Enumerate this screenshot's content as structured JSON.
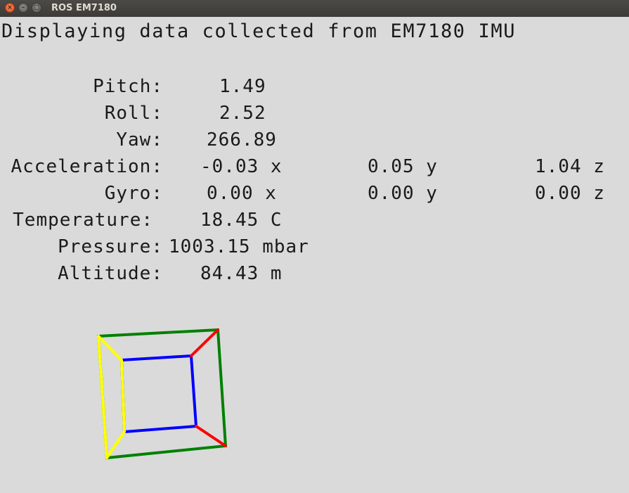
{
  "window": {
    "title": "ROS EM7180",
    "close_glyph": "×",
    "min_glyph": "–",
    "max_glyph": "□"
  },
  "heading": "Displaying data collected from EM7180 IMU",
  "readings": {
    "pitch": {
      "label": "Pitch:",
      "value": "1.49"
    },
    "roll": {
      "label": "Roll:",
      "value": "2.52"
    },
    "yaw": {
      "label": "Yaw:",
      "value": "266.89"
    },
    "accel": {
      "label": "Acceleration:",
      "x": "-0.03 x",
      "y": "0.05 y",
      "z": "1.04 z"
    },
    "gyro": {
      "label": "Gyro:",
      "x": "0.00 x",
      "y": "0.00 y",
      "z": "0.00 z"
    },
    "temperature": {
      "label": "Temperature:",
      "value": "18.45 C"
    },
    "pressure": {
      "label": "Pressure:",
      "value": "1003.15 mbar"
    },
    "altitude": {
      "label": "Altitude:",
      "value": "84.43 m"
    }
  },
  "colors": {
    "background": "#dadada",
    "outer_face": "#008000",
    "inner_face": "#0000ff",
    "left_edges": "#ffff00",
    "right_edges": "#ff0000"
  }
}
